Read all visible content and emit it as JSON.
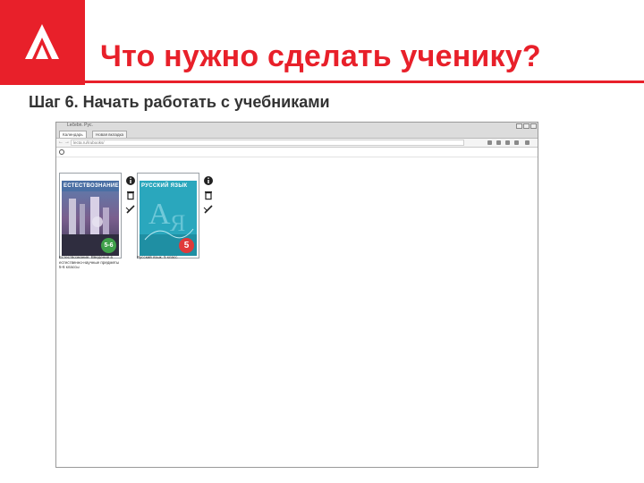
{
  "slide": {
    "title": "Что нужно сделать ученику?",
    "subtitle": "Шаг 6. Начать работать с учебниками"
  },
  "browser": {
    "window_title": "Lečebn. Рус.",
    "tabs": [
      {
        "label": "Календарь",
        "active": true
      },
      {
        "label": "Новая вкладка",
        "active": false
      }
    ],
    "address": "lecta.ru/\\rubooks/",
    "books": [
      {
        "cover_title": "ЕСТЕСТВОЗНАНИЕ",
        "grade": "5-6",
        "caption": "Естествознание. Введение в естественно-научные предметы 5-6 классы",
        "badge_color": "#3fa04a"
      },
      {
        "cover_title": "РУССКИЙ ЯЗЫК",
        "grade": "5",
        "caption": "Русский язык. 5 класс",
        "badge_color": "#e03a3a"
      }
    ]
  },
  "colors": {
    "brand_red": "#e8202a",
    "subtitle_gray": "#333333"
  },
  "icons": [
    "logo-icon",
    "back-icon",
    "forward-icon",
    "reload-icon",
    "home-icon",
    "info-icon",
    "trash-icon",
    "edit-icon",
    "app-icon"
  ]
}
